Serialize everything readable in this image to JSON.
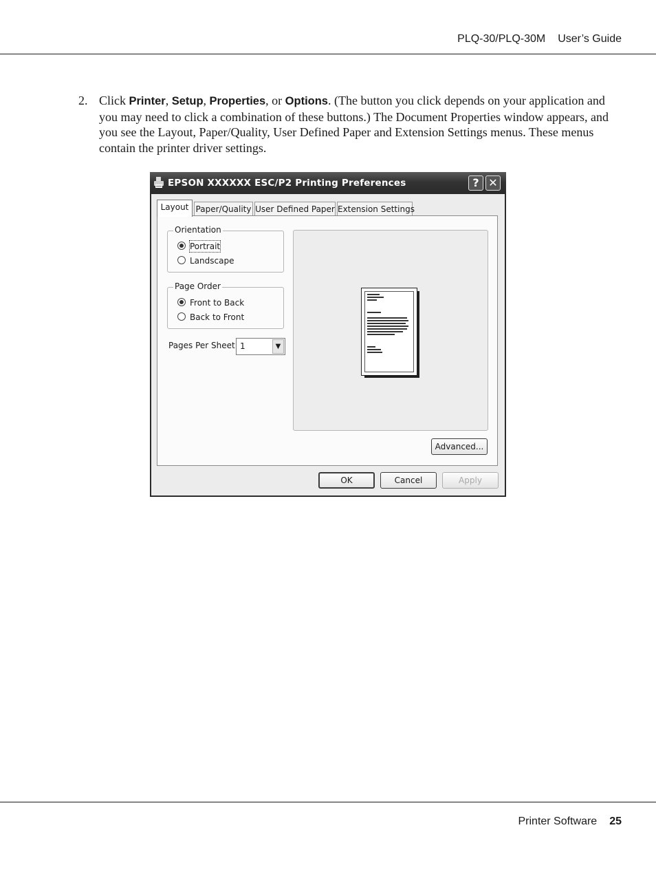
{
  "header": {
    "product": "PLQ-30/PLQ-30M",
    "doc": "User’s Guide"
  },
  "step": {
    "number": "2.",
    "prefix": "Click ",
    "b1": "Printer",
    "sep1": ", ",
    "b2": "Setup",
    "sep2": ", ",
    "b3": "Properties",
    "sep3": ", or ",
    "b4": "Options",
    "rest": ". (The button you click depends on your application and you may need to click a combination of these buttons.) The Document Properties window appears, and you see the Layout, Paper/Quality, User Defined Paper and Extension Settings menus. These menus contain the printer driver settings."
  },
  "dialog": {
    "title": "EPSON XXXXXX ESC/P2 Printing Preferences",
    "help_glyph": "?",
    "close_glyph": "✕",
    "tabs": [
      "Layout",
      "Paper/Quality",
      "User Defined Paper",
      "Extension Settings"
    ],
    "active_tab": "Layout",
    "orientation": {
      "legend": "Orientation",
      "options": [
        {
          "label": "Portrait",
          "selected": true
        },
        {
          "label": "Landscape",
          "selected": false
        }
      ]
    },
    "page_order": {
      "legend": "Page Order",
      "options": [
        {
          "label": "Front to Back",
          "selected": true
        },
        {
          "label": "Back to Front",
          "selected": false
        }
      ]
    },
    "pages_per_sheet": {
      "label": "Pages Per Sheet:",
      "value": "1",
      "arrow_glyph": "▼"
    },
    "buttons": {
      "advanced": "Advanced...",
      "ok": "OK",
      "cancel": "Cancel",
      "apply": "Apply"
    }
  },
  "footer": {
    "section": "Printer Software",
    "page": "25"
  },
  "icons": {
    "printer": "printer-icon",
    "help": "help-icon",
    "close": "close-icon",
    "dropdown": "chevron-down-icon"
  }
}
